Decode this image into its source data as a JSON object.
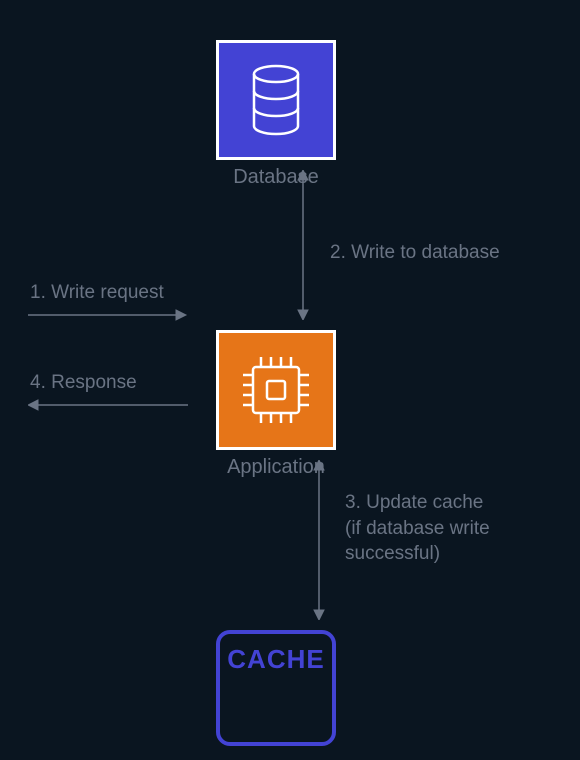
{
  "nodes": {
    "database": {
      "label": "Database"
    },
    "application": {
      "label": "Application"
    },
    "cache": {
      "text": "CACHE"
    }
  },
  "steps": {
    "s1": "1. Write request",
    "s2": "2. Write to database",
    "s3_line1": "3. Update cache",
    "s3_line2": "(if database write",
    "s3_line3": "successful)",
    "s4": "4. Response"
  },
  "colors": {
    "background": "#0a1520",
    "database_bg": "#4343d4",
    "application_bg": "#e67518",
    "cache_border": "#4343d4",
    "text": "#6a7484",
    "icon_stroke": "#ffffff"
  }
}
